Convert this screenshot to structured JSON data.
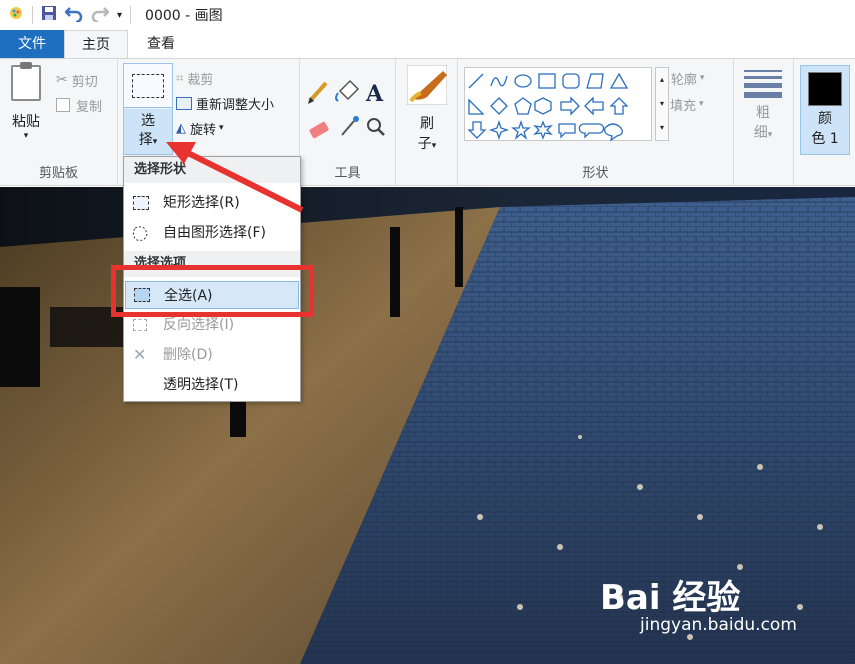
{
  "titlebar": {
    "title": "0000 - 画图",
    "icons": [
      "paint-app-icon",
      "save-icon",
      "undo-icon",
      "redo-icon",
      "customize-qat-icon"
    ]
  },
  "tabs": [
    {
      "label": "文件",
      "active": false
    },
    {
      "label": "主页",
      "active": true
    },
    {
      "label": "查看",
      "active": false
    }
  ],
  "clipboard": {
    "paste": "粘贴",
    "cut": "剪切",
    "copy": "复制",
    "group_label": "剪贴板"
  },
  "image_group": {
    "select_line1": "选",
    "select_line2": "择",
    "crop": "裁剪",
    "resize": "重新调整大小",
    "rotate": "旋转"
  },
  "tools": {
    "group_label": "工具",
    "items": [
      "pencil-icon",
      "fill-icon",
      "text-icon",
      "eraser-icon",
      "color-picker-icon",
      "magnifier-icon"
    ]
  },
  "brush": {
    "line1": "刷",
    "line2": "子"
  },
  "shapes": {
    "group_label": "形状",
    "outline": "轮廓",
    "fill": "填充"
  },
  "size": {
    "line1": "粗",
    "line2": "细"
  },
  "colors": {
    "color1_line1": "颜",
    "color1_line2": "色 1",
    "color1_value": "#000000"
  },
  "select_menu": {
    "header_shape": "选择形状",
    "rect_select": "矩形选择(R)",
    "free_select": "自由图形选择(F)",
    "header_options": "选择选项",
    "select_all": "全选(A)",
    "invert": "反向选择(I)",
    "delete": "删除(D)",
    "transparent": "透明选择(T)"
  },
  "watermark": {
    "logo": "Bai 经验",
    "url": "jingyan.baidu.com"
  },
  "accent": {
    "blue": "#1e6fc0",
    "highlight": "#e8322f"
  }
}
